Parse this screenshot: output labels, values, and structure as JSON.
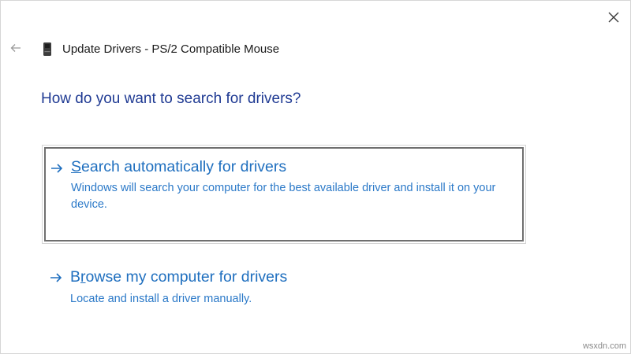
{
  "window": {
    "close_icon": "close-icon",
    "back_icon": "back-arrow-icon"
  },
  "header": {
    "device_icon": "mouse-device-icon",
    "title": "Update Drivers - PS/2 Compatible Mouse"
  },
  "main": {
    "heading": "How do you want to search for drivers?",
    "options": [
      {
        "title_access_key": "S",
        "title_rest": "earch automatically for drivers",
        "description": "Windows will search your computer for the best available driver and install it on your device.",
        "icon": "arrow-right-icon"
      },
      {
        "title_prefix": "B",
        "title_access_key": "r",
        "title_rest": "owse my computer for drivers",
        "description": "Locate and install a driver manually.",
        "icon": "arrow-right-icon"
      }
    ]
  },
  "watermark": "wsxdn.com",
  "colors": {
    "heading": "#1f3a93",
    "link": "#1f6fbf",
    "link_description": "#2b79c8",
    "focus_border": "#6f6f6f"
  }
}
